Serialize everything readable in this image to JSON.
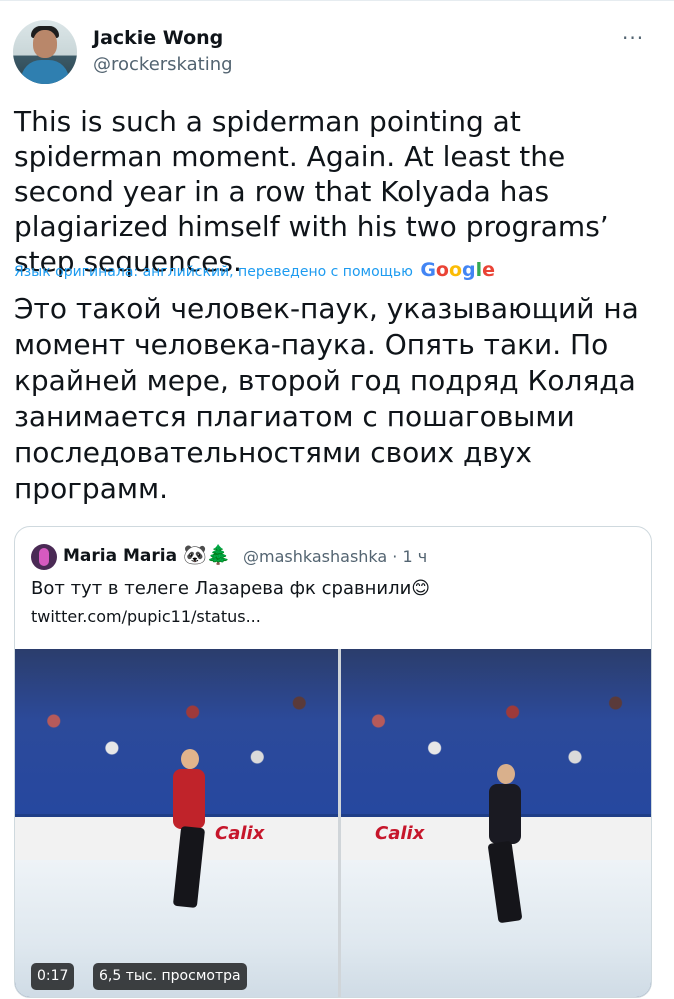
{
  "tweet": {
    "author_name": "Jackie Wong",
    "author_handle": "@rockerskating",
    "more_icon": "···",
    "text": "This is such a spiderman pointing at spiderman moment. Again. At least the second year in a row that Kolyada has plagiarized himself with his two programs’ step sequences.",
    "translation_note": "Язык оригинала: английский, переведено с помощью",
    "translator_logo": [
      "G",
      "o",
      "o",
      "g",
      "l",
      "e"
    ],
    "translated_text": "Это такой человек-паук, указывающий на момент человека-паука. Опять таки. По крайней мере, второй год подряд Коляда занимается плагиатом с пошаговыми последовательностями своих двух программ."
  },
  "quote": {
    "author_name": "Maria Maria",
    "author_emoji": "🐼🌲",
    "author_handle": "@mashkashashka",
    "separator": "·",
    "time": "1 ч",
    "text": "Вот тут в телеге Лазарева фк сравнили😊",
    "link": "twitter.com/pupic11/status..."
  },
  "video": {
    "duration": "0:17",
    "views": "6,5 тыс. просмотра",
    "left_ad": "Calix",
    "right_ad": "Calix"
  },
  "colors": {
    "accent": "#1d9bf0",
    "secondary_text": "#536471",
    "border": "#cfd9de"
  }
}
